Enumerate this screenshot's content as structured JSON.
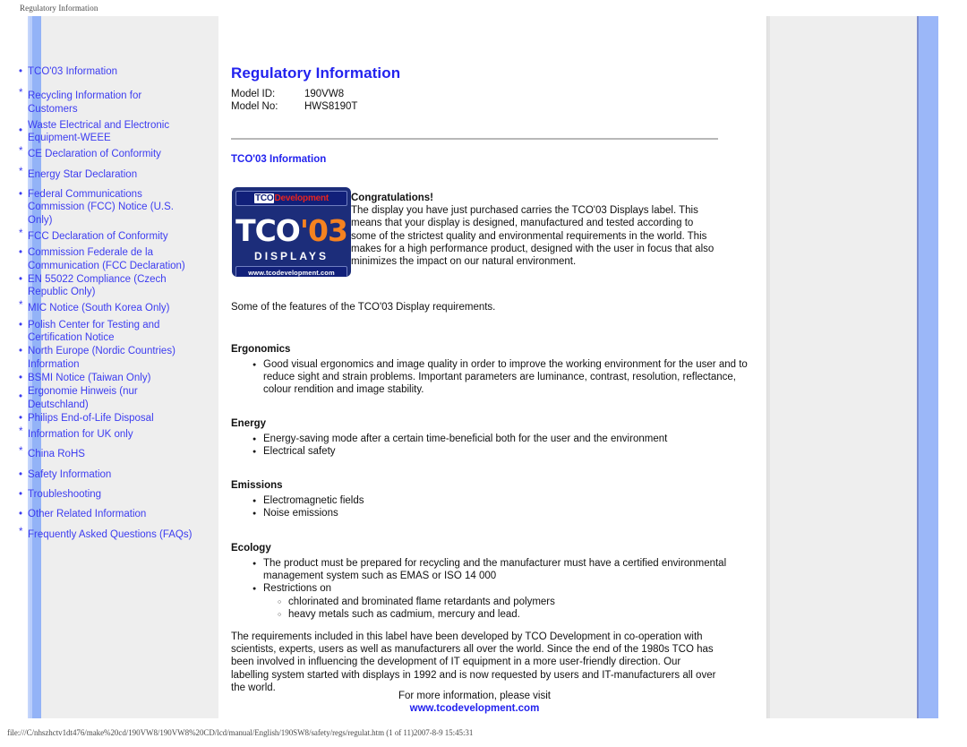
{
  "print": {
    "header": "Regulatory Information",
    "footer": "file:///C/nhszhctv1dt476/make%20cd/190VW8/190VW8%20CD/lcd/manual/English/190SW8/safety/regs/regulat.htm (1 of 11)2007-8-9 15:45:31"
  },
  "colors": {
    "link": "#3c3cf0",
    "title": "#2222ee",
    "panel_bg": "#eeeeee",
    "rail_blue": "#93b3f7",
    "logo_navy": "#1c2d7a",
    "logo_orange": "#f58220",
    "logo_red": "#e8231f"
  },
  "sidebar": {
    "items": [
      {
        "label": "TCO'03 Information",
        "bullet": "•",
        "gap": "gap-lg",
        "bpos": ""
      },
      {
        "label": "Recycling Information for Customers",
        "bullet": "*",
        "gap": "gap-lg",
        "bpos": "b-hi"
      },
      {
        "label": "Waste Electrical and Electronic Equipment-WEEE",
        "bullet": "•",
        "gap": "gap-sm",
        "bpos": "b-mid"
      },
      {
        "label": "CE Declaration of Conformity",
        "bullet": "*",
        "gap": "gap-sm",
        "bpos": "b-hi"
      },
      {
        "label": "Energy Star Declaration",
        "bullet": "*",
        "gap": "gap-md",
        "bpos": "b-hi"
      },
      {
        "label": "Federal Communications Commission (FCC) Notice (U.S. Only)",
        "bullet": "•",
        "gap": "gap-md",
        "bpos": ""
      },
      {
        "label": "FCC Declaration of Conformity",
        "bullet": "*",
        "gap": "gap-sm",
        "bpos": "b-hi"
      },
      {
        "label": "Commission Federale de la Communication (FCC Declaration)",
        "bullet": "•",
        "gap": "gap-sm",
        "bpos": ""
      },
      {
        "label": "EN 55022 Compliance (Czech Republic Only)",
        "bullet": "•",
        "gap": "gap-xs",
        "bpos": ""
      },
      {
        "label": "MIC Notice (South Korea Only)",
        "bullet": "*",
        "gap": "gap-sm",
        "bpos": "b-hi"
      },
      {
        "label": "Polish Center for Testing and Certification Notice",
        "bullet": "•",
        "gap": "gap-sm",
        "bpos": ""
      },
      {
        "label": "North Europe (Nordic Countries) Information",
        "bullet": "•",
        "gap": "gap-xs",
        "bpos": ""
      },
      {
        "label": "BSMI Notice (Taiwan Only)",
        "bullet": "•",
        "gap": "gap-xs",
        "bpos": ""
      },
      {
        "label": "Ergonomie Hinweis (nur Deutschland)",
        "bullet": "•",
        "gap": "gap-xs",
        "bpos": "b-mid"
      },
      {
        "label": "Philips End-of-Life Disposal",
        "bullet": "•",
        "gap": "gap-xs",
        "bpos": ""
      },
      {
        "label": "Information for UK only",
        "bullet": "*",
        "gap": "gap-sm",
        "bpos": "b-hi"
      },
      {
        "label": "China RoHS",
        "bullet": "*",
        "gap": "gap-md",
        "bpos": "b-hi"
      },
      {
        "label": "Safety Information",
        "bullet": "•",
        "gap": "gap-md",
        "bpos": ""
      },
      {
        "label": "Troubleshooting",
        "bullet": "•",
        "gap": "gap-md",
        "bpos": ""
      },
      {
        "label": "Other Related Information",
        "bullet": "•",
        "gap": "gap-md",
        "bpos": ""
      },
      {
        "label": "Frequently Asked Questions (FAQs)",
        "bullet": "*",
        "gap": "gap-md",
        "bpos": "b-hi"
      }
    ]
  },
  "main": {
    "title": "Regulatory Information",
    "model": {
      "id_label": "Model ID:",
      "id_value": "190VW8",
      "no_label": "Model No:",
      "no_value": "HWS8190T"
    },
    "section_title": "TCO'03 Information",
    "logo": {
      "band_tco": "TCO",
      "band_development": "Development",
      "big_tco": "TCO",
      "big_year": "'03",
      "displays": "DISPLAYS",
      "url": "www.tcodevelopment.com"
    },
    "congratulations": {
      "heading": "Congratulations!",
      "body": "The display you have just purchased carries the TCO'03 Displays label. This means that your display is designed, manufactured and tested according to some of the strictest quality and environmental requirements in the world. This makes for a high performance product, designed with the user in focus that also minimizes the impact on our natural environment."
    },
    "features_intro": "Some of the features of the TCO'03 Display requirements.",
    "sections": {
      "ergonomics": {
        "heading": "Ergonomics",
        "items": [
          "Good visual ergonomics and image quality in order to improve the working environment for the user and to reduce sight and strain problems. Important parameters are luminance, contrast, resolution, reflectance, colour rendition and image stability."
        ]
      },
      "energy": {
        "heading": "Energy",
        "items": [
          "Energy-saving mode after a certain time-beneficial both for the user and the environment",
          "Electrical safety"
        ]
      },
      "emissions": {
        "heading": "Emissions",
        "items": [
          "Electromagnetic fields",
          "Noise emissions"
        ]
      },
      "ecology": {
        "heading": "Ecology",
        "items": [
          "The product must be prepared for recycling and the manufacturer must have a certified environmental management system such as EMAS or ISO 14 000",
          "Restrictions on"
        ],
        "subitems": [
          "chlorinated and brominated flame retardants and polymers",
          "heavy metals such as cadmium, mercury and lead."
        ]
      }
    },
    "closing": "The requirements included in this label have been developed by TCO Development in co-operation with scientists, experts, users as well as manufacturers all over the world. Since the end of the 1980s TCO has been involved in influencing the development of IT equipment in a more user-friendly direction. Our labelling system started with displays in 1992 and is now requested by users and IT-manufacturers all over the world.",
    "visit_text": "For more information, please visit",
    "visit_url": "www.tcodevelopment.com"
  }
}
